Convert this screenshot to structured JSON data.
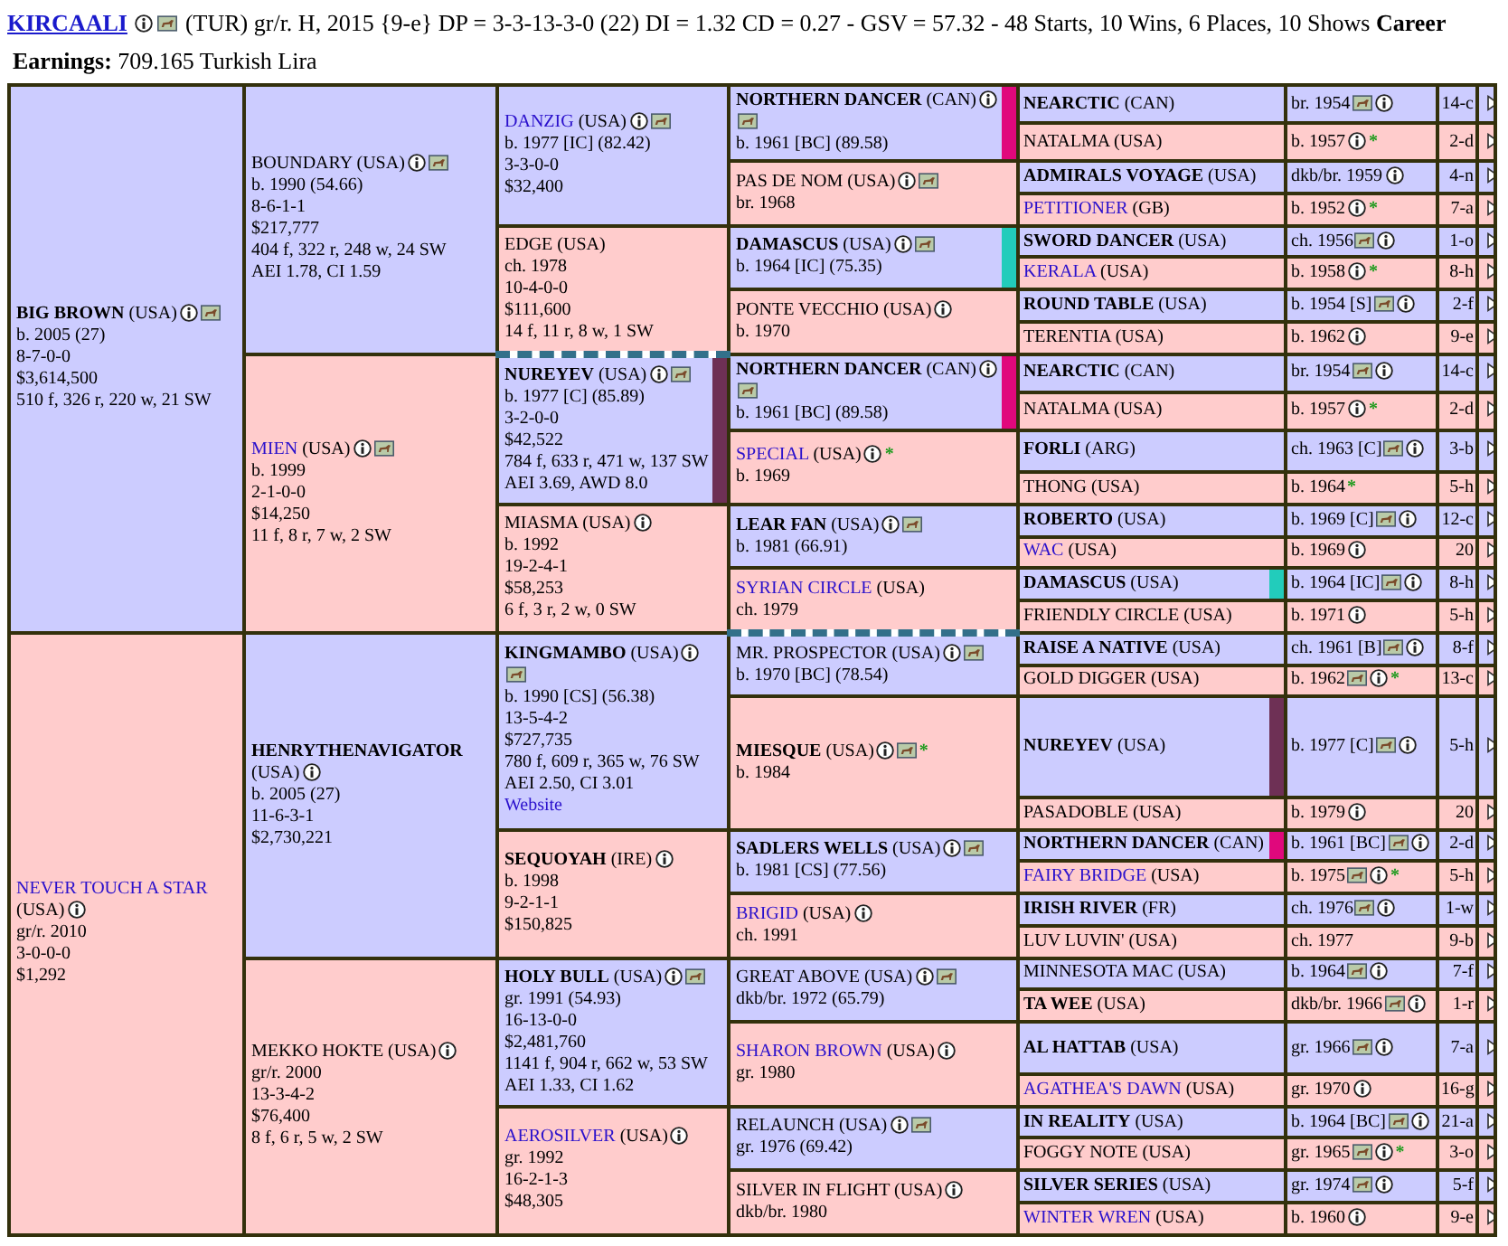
{
  "horse": {
    "name": "KIRCAALI",
    "info": true,
    "photo": true,
    "summary": "(TUR) gr/r. H, 2015 {9-e} DP = 3-3-13-3-0 (22) DI = 1.32   CD = 0.27 - GSV = 57.32 - 48 Starts, 10 Wins, 6 Places, 10 Shows **Career**",
    "earnings": "**Earnings:** 709.165 Turkish Lira",
    "parents": [
      {
        "name": "BIG BROWN",
        "country": "(USA)",
        "kind": "bold",
        "info": true,
        "photo": true,
        "details": [
          "b. 2005 (27)",
          "8-7-0-0",
          "$3,614,500",
          "510 f, 326 r, 220 w, 21 SW"
        ],
        "parents": [
          {
            "name": "BOUNDARY",
            "country": "(USA)",
            "kind": "plain",
            "info": true,
            "photo": true,
            "details": [
              "b. 1990 (54.66)",
              "8-6-1-1",
              "$217,777",
              "404 f, 322 r, 248 w, 24 SW",
              "AEI 1.78, CI 1.59"
            ],
            "parents": [
              {
                "name": "DANZIG",
                "country": "(USA)",
                "kind": "link",
                "info": true,
                "photo": true,
                "details": [
                  "b. 1977 [IC] (82.42)",
                  "3-3-0-0",
                  "$32,400"
                ],
                "parents": [
                  {
                    "name": "NORTHERN DANCER",
                    "country": "(CAN)",
                    "kind": "bold",
                    "info": true,
                    "photo": true,
                    "details": [
                      "b. 1961 [BC] (89.58)"
                    ],
                    "color": "#e0087c",
                    "parents": [
                      {
                        "name": "NEARCTIC",
                        "country": "(CAN)",
                        "kind": "bold",
                        "birth": "br. 1954",
                        "photo": true,
                        "info": true,
                        "family": "14-c"
                      },
                      {
                        "name": "NATALMA",
                        "country": "(USA)",
                        "kind": "plain",
                        "birth": "b. 1957",
                        "info": true,
                        "mark": "*",
                        "family": "2-d"
                      }
                    ]
                  },
                  {
                    "name": "PAS DE NOM",
                    "country": "(USA)",
                    "kind": "plain",
                    "info": true,
                    "photo": true,
                    "details": [
                      "br. 1968"
                    ],
                    "parents": [
                      {
                        "name": "ADMIRALS VOYAGE",
                        "country": "(USA)",
                        "kind": "bold",
                        "birth": "dkb/br. 1959",
                        "info": true,
                        "family": "4-n"
                      },
                      {
                        "name": "PETITIONER",
                        "country": "(GB)",
                        "kind": "link",
                        "birth": "b. 1952",
                        "info": true,
                        "mark": "*",
                        "family": "7-a"
                      }
                    ]
                  }
                ]
              },
              {
                "name": "EDGE",
                "country": "(USA)",
                "kind": "plain",
                "details": [
                  "ch. 1978",
                  "10-4-0-0",
                  "$111,600",
                  "14 f, 11 r, 8 w, 1 SW"
                ],
                "dashed": true,
                "parents": [
                  {
                    "name": "DAMASCUS",
                    "country": "(USA)",
                    "kind": "bold",
                    "info": true,
                    "photo": true,
                    "details": [
                      "b. 1964 [IC] (75.35)"
                    ],
                    "color": "#22ccbb",
                    "parents": [
                      {
                        "name": "SWORD DANCER",
                        "country": "(USA)",
                        "kind": "bold",
                        "birth": "ch. 1956",
                        "photo": true,
                        "info": true,
                        "family": "1-o"
                      },
                      {
                        "name": "KERALA",
                        "country": "(USA)",
                        "kind": "link",
                        "birth": "b. 1958",
                        "info": true,
                        "mark": "*",
                        "family": "8-h"
                      }
                    ]
                  },
                  {
                    "name": "PONTE VECCHIO",
                    "country": "(USA)",
                    "kind": "plain",
                    "info": true,
                    "details": [
                      "b. 1970"
                    ],
                    "parents": [
                      {
                        "name": "ROUND TABLE",
                        "country": "(USA)",
                        "kind": "bold",
                        "birth": "b. 1954 [S]",
                        "photo": true,
                        "info": true,
                        "family": "2-f"
                      },
                      {
                        "name": "TERENTIA",
                        "country": "(USA)",
                        "kind": "plain",
                        "birth": "b. 1962",
                        "info": true,
                        "family": "9-e"
                      }
                    ]
                  }
                ]
              }
            ]
          },
          {
            "name": "MIEN",
            "country": "(USA)",
            "kind": "link",
            "info": true,
            "photo": true,
            "details": [
              "b. 1999",
              "2-1-0-0",
              "$14,250",
              "11 f, 8 r, 7 w, 2 SW"
            ],
            "parents": [
              {
                "name": "NUREYEV",
                "country": "(USA)",
                "kind": "bold",
                "info": true,
                "photo": true,
                "details": [
                  "b. 1977 [C] (85.89)",
                  "3-2-0-0",
                  "$42,522",
                  "784 f, 633 r, 471 w, 137 SW",
                  "AEI 3.69, AWD 8.0"
                ],
                "color": "#6e3055",
                "parents": [
                  {
                    "name": "NORTHERN DANCER",
                    "country": "(CAN)",
                    "kind": "bold",
                    "info": true,
                    "photo": true,
                    "details": [
                      "b. 1961 [BC] (89.58)"
                    ],
                    "color": "#e0087c",
                    "parents": [
                      {
                        "name": "NEARCTIC",
                        "country": "(CAN)",
                        "kind": "bold",
                        "birth": "br. 1954",
                        "photo": true,
                        "info": true,
                        "family": "14-c"
                      },
                      {
                        "name": "NATALMA",
                        "country": "(USA)",
                        "kind": "plain",
                        "birth": "b. 1957",
                        "info": true,
                        "mark": "*",
                        "family": "2-d"
                      }
                    ]
                  },
                  {
                    "name": "SPECIAL",
                    "country": "(USA)",
                    "kind": "link",
                    "info": true,
                    "mark": "*",
                    "details": [
                      "b. 1969"
                    ],
                    "parents": [
                      {
                        "name": "FORLI",
                        "country": "(ARG)",
                        "kind": "bold",
                        "birth": "ch. 1963 [C]",
                        "photo": true,
                        "info": true,
                        "family": "3-b"
                      },
                      {
                        "name": "THONG",
                        "country": "(USA)",
                        "kind": "plain",
                        "birth": "b. 1964",
                        "mark": "*",
                        "family": "5-h"
                      }
                    ]
                  }
                ]
              },
              {
                "name": "MIASMA",
                "country": "(USA)",
                "kind": "plain",
                "info": true,
                "details": [
                  "b. 1992",
                  "19-2-4-1",
                  "$58,253",
                  "6 f, 3 r, 2 w, 0 SW"
                ],
                "parents": [
                  {
                    "name": "LEAR FAN",
                    "country": "(USA)",
                    "kind": "bold",
                    "info": true,
                    "photo": true,
                    "details": [
                      "b. 1981 (66.91)"
                    ],
                    "parents": [
                      {
                        "name": "ROBERTO",
                        "country": "(USA)",
                        "kind": "bold",
                        "birth": "b. 1969 [C]",
                        "photo": true,
                        "info": true,
                        "family": "12-c"
                      },
                      {
                        "name": "WAC",
                        "country": "(USA)",
                        "kind": "link",
                        "birth": "b. 1969",
                        "info": true,
                        "family": "20"
                      }
                    ]
                  },
                  {
                    "name": "SYRIAN CIRCLE",
                    "country": "(USA)",
                    "kind": "link",
                    "details": [
                      "ch. 1979"
                    ],
                    "dashed": true,
                    "parents": [
                      {
                        "name": "DAMASCUS",
                        "country": "(USA)",
                        "kind": "bold",
                        "birth": "b. 1964 [IC]",
                        "photo": true,
                        "info": true,
                        "family": "8-h",
                        "color": "#22ccbb"
                      },
                      {
                        "name": "FRIENDLY CIRCLE",
                        "country": "(USA)",
                        "kind": "plain",
                        "birth": "b. 1971",
                        "info": true,
                        "family": "5-h"
                      }
                    ]
                  }
                ]
              }
            ]
          }
        ]
      },
      {
        "name": "NEVER TOUCH A STAR",
        "country": "(USA)",
        "kind": "link",
        "info": true,
        "details": [
          "gr/r. 2010",
          "3-0-0-0",
          "$1,292"
        ],
        "parents": [
          {
            "name": "HENRYTHENAVIGATOR",
            "country": "(USA)",
            "kind": "bold",
            "info": true,
            "details": [
              "b. 2005 (27)",
              "11-6-3-1",
              "$2,730,221"
            ],
            "parents": [
              {
                "name": "KINGMAMBO",
                "country": "(USA)",
                "kind": "bold",
                "info": true,
                "photo": true,
                "details": [
                  "b. 1990 [CS] (56.38)",
                  "13-5-4-2",
                  "$727,735",
                  "780 f, 609 r, 365 w, 76 SW",
                  "AEI 2.50, CI 3.01"
                ],
                "link": "Website",
                "parents": [
                  {
                    "name": "MR. PROSPECTOR",
                    "country": "(USA)",
                    "kind": "plain",
                    "info": true,
                    "photo": true,
                    "details": [
                      "b. 1970 [BC] (78.54)"
                    ],
                    "parents": [
                      {
                        "name": "RAISE A NATIVE",
                        "country": "(USA)",
                        "kind": "bold",
                        "birth": "ch. 1961 [B]",
                        "photo": true,
                        "info": true,
                        "family": "8-f"
                      },
                      {
                        "name": "GOLD DIGGER",
                        "country": "(USA)",
                        "kind": "plain",
                        "birth": "b. 1962",
                        "photo": true,
                        "info": true,
                        "mark": "*",
                        "family": "13-c"
                      }
                    ]
                  },
                  {
                    "name": "MIESQUE",
                    "country": "(USA)",
                    "kind": "bold",
                    "info": true,
                    "photo": true,
                    "mark": "*",
                    "details": [
                      "b. 1984"
                    ],
                    "parents": [
                      {
                        "name": "NUREYEV",
                        "country": "(USA)",
                        "kind": "bold",
                        "birth": "b. 1977 [C]",
                        "photo": true,
                        "info": true,
                        "family": "5-h",
                        "color": "#6e3055"
                      },
                      {
                        "name": "PASADOBLE",
                        "country": "(USA)",
                        "kind": "plain",
                        "birth": "b. 1979",
                        "info": true,
                        "family": "20"
                      }
                    ]
                  }
                ]
              },
              {
                "name": "SEQUOYAH",
                "country": "(IRE)",
                "kind": "bold",
                "info": true,
                "details": [
                  "b. 1998",
                  "9-2-1-1",
                  "$150,825"
                ],
                "parents": [
                  {
                    "name": "SADLERS WELLS",
                    "country": "(USA)",
                    "kind": "bold",
                    "info": true,
                    "photo": true,
                    "details": [
                      "b. 1981 [CS] (77.56)"
                    ],
                    "parents": [
                      {
                        "name": "NORTHERN DANCER",
                        "country": "(CAN)",
                        "kind": "bold",
                        "birth": "b. 1961 [BC]",
                        "photo": true,
                        "info": true,
                        "family": "2-d",
                        "color": "#e0087c"
                      },
                      {
                        "name": "FAIRY BRIDGE",
                        "country": "(USA)",
                        "kind": "link",
                        "birth": "b. 1975",
                        "photo": true,
                        "info": true,
                        "mark": "*",
                        "family": "5-h"
                      }
                    ]
                  },
                  {
                    "name": "BRIGID",
                    "country": "(USA)",
                    "kind": "link",
                    "info": true,
                    "details": [
                      "ch. 1991"
                    ],
                    "parents": [
                      {
                        "name": "IRISH RIVER",
                        "country": "(FR)",
                        "kind": "bold",
                        "birth": "ch. 1976",
                        "photo": true,
                        "info": true,
                        "family": "1-w"
                      },
                      {
                        "name": "LUV LUVIN'",
                        "country": "(USA)",
                        "kind": "plain",
                        "birth": "ch. 1977",
                        "family": "9-b"
                      }
                    ]
                  }
                ]
              }
            ]
          },
          {
            "name": "MEKKO HOKTE",
            "country": "(USA)",
            "kind": "plain",
            "info": true,
            "details": [
              "gr/r. 2000",
              "13-3-4-2",
              "$76,400",
              "8 f, 6 r, 5 w, 2 SW"
            ],
            "parents": [
              {
                "name": "HOLY BULL",
                "country": "(USA)",
                "kind": "bold",
                "info": true,
                "photo": true,
                "details": [
                  "gr. 1991 (54.93)",
                  "16-13-0-0",
                  "$2,481,760",
                  "1141 f, 904 r, 662 w, 53 SW",
                  "AEI 1.33, CI 1.62"
                ],
                "parents": [
                  {
                    "name": "GREAT ABOVE",
                    "country": "(USA)",
                    "kind": "plain",
                    "info": true,
                    "photo": true,
                    "details": [
                      "dkb/br. 1972 (65.79)"
                    ],
                    "parents": [
                      {
                        "name": "MINNESOTA MAC",
                        "country": "(USA)",
                        "kind": "plain",
                        "birth": "b. 1964",
                        "photo": true,
                        "info": true,
                        "family": "7-f"
                      },
                      {
                        "name": "TA WEE",
                        "country": "(USA)",
                        "kind": "bold",
                        "birth": "dkb/br. 1966",
                        "photo": true,
                        "info": true,
                        "family": "1-r"
                      }
                    ]
                  },
                  {
                    "name": "SHARON BROWN",
                    "country": "(USA)",
                    "kind": "link",
                    "info": true,
                    "details": [
                      "gr. 1980"
                    ],
                    "parents": [
                      {
                        "name": "AL HATTAB",
                        "country": "(USA)",
                        "kind": "bold",
                        "birth": "gr. 1966",
                        "photo": true,
                        "info": true,
                        "family": "7-a"
                      },
                      {
                        "name": "AGATHEA'S DAWN",
                        "country": "(USA)",
                        "kind": "link",
                        "birth": "gr. 1970",
                        "info": true,
                        "family": "16-g"
                      }
                    ]
                  }
                ]
              },
              {
                "name": "AEROSILVER",
                "country": "(USA)",
                "kind": "link",
                "info": true,
                "details": [
                  "gr. 1992",
                  "16-2-1-3",
                  "$48,305"
                ],
                "parents": [
                  {
                    "name": "RELAUNCH",
                    "country": "(USA)",
                    "kind": "plain",
                    "info": true,
                    "photo": true,
                    "details": [
                      "gr. 1976 (69.42)"
                    ],
                    "parents": [
                      {
                        "name": "IN REALITY",
                        "country": "(USA)",
                        "kind": "bold",
                        "birth": "b. 1964 [BC]",
                        "photo": true,
                        "info": true,
                        "family": "21-a"
                      },
                      {
                        "name": "FOGGY NOTE",
                        "country": "(USA)",
                        "kind": "plain",
                        "birth": "gr. 1965",
                        "photo": true,
                        "info": true,
                        "mark": "*",
                        "family": "3-o"
                      }
                    ]
                  },
                  {
                    "name": "SILVER IN FLIGHT",
                    "country": "(USA)",
                    "kind": "plain",
                    "info": true,
                    "details": [
                      "dkb/br. 1980"
                    ],
                    "parents": [
                      {
                        "name": "SILVER SERIES",
                        "country": "(USA)",
                        "kind": "bold",
                        "birth": "gr. 1974",
                        "photo": true,
                        "info": true,
                        "family": "5-f"
                      },
                      {
                        "name": "WINTER WREN",
                        "country": "(USA)",
                        "kind": "link",
                        "birth": "b. 1960",
                        "info": true,
                        "family": "9-e"
                      }
                    ]
                  }
                ]
              }
            ]
          }
        ]
      }
    ]
  }
}
